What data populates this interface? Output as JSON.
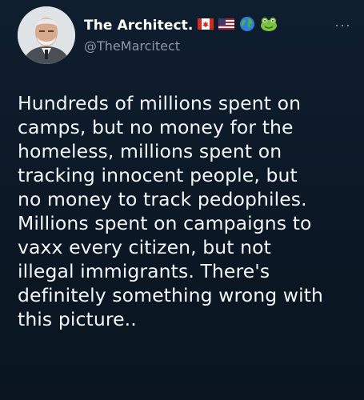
{
  "tweet": {
    "author": {
      "display_name": "The Architect.",
      "handle": "@TheMarcitect",
      "name_emojis": [
        "canada-flag-icon",
        "us-flag-icon",
        "globe-icon",
        "frog-icon"
      ]
    },
    "more_label": "···",
    "text_lines": [
      "Hundreds of millions spent on",
      "camps, but no money for the",
      "homeless, millions spent on",
      "tracking innocent people, but",
      "no money to track pedophiles.",
      "Millions spent on campaigns to",
      "vaxx every citizen, but not",
      "illegal immigrants. There's",
      "definitely something wrong with",
      "this picture.."
    ]
  },
  "colors": {
    "background": "#0b1724",
    "text": "#f3f5f7",
    "secondary": "#8b98a5"
  }
}
